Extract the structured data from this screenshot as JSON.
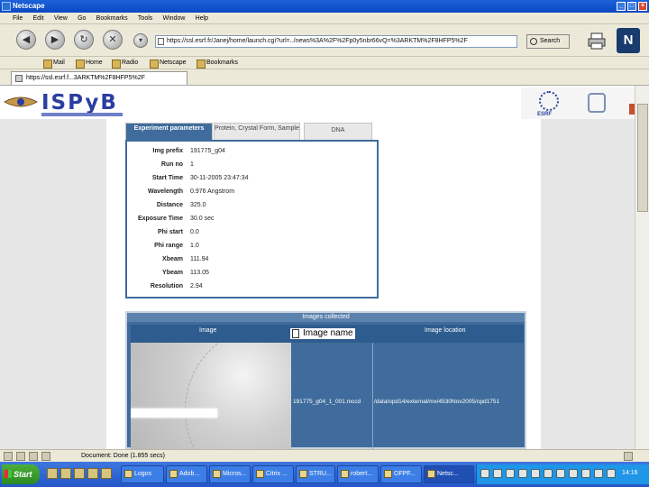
{
  "window": {
    "title": "Netscape"
  },
  "menu": [
    "File",
    "Edit",
    "View",
    "Go",
    "Bookmarks",
    "Tools",
    "Window",
    "Help"
  ],
  "nav": {
    "url": "https://ssl.esrf.fr/Janej/home/launch.cgi?url=../news%3A%2F%2Fp0y5nbr66vQ=%3ARKTM%2F8HFP5%2F",
    "search_label": "Search"
  },
  "bookmarks": [
    "Mail",
    "Home",
    "Radio",
    "Netscape",
    "Bookmarks"
  ],
  "tab": {
    "label": "https://ssl.esrf.f...3ARKTM%2F8HFP5%2F"
  },
  "banner": {
    "logo_text": "ISPyB",
    "esrf_label": "ESRF"
  },
  "param_tabs": [
    {
      "label": "Experiment parameters",
      "active": true
    },
    {
      "label": "Protein, Crystal Form, Sample",
      "active": false
    },
    {
      "label": "DNA",
      "active": false
    }
  ],
  "params": [
    {
      "label": "Img prefix",
      "value": "191775_g04"
    },
    {
      "label": "Run no",
      "value": "1"
    },
    {
      "label": "Start Time",
      "value": "30-11-2005 23:47:34"
    },
    {
      "label": "Wavelength",
      "value": "0.976 Angstrom"
    },
    {
      "label": "Distance",
      "value": "325.0"
    },
    {
      "label": "Exposure Time",
      "value": "30.0 sec"
    },
    {
      "label": "Phi start",
      "value": "0.0"
    },
    {
      "label": "Phi range",
      "value": "1.0"
    },
    {
      "label": "Xbeam",
      "value": "111.94"
    },
    {
      "label": "Ybeam",
      "value": "113.05"
    },
    {
      "label": "Resolution",
      "value": "2.94"
    }
  ],
  "images": {
    "title": "Images collected",
    "col_image": "Image",
    "col_name": "Image name",
    "col_location": "Image location",
    "file_name": "191775_g04_1_001.mccd",
    "location": "/data/opd14/external/mx/4530Nov2005/opd1751"
  },
  "status": {
    "text": "Document: Done (1.855 secs)"
  },
  "taskbar": {
    "start": "Start",
    "tasks": [
      {
        "label": "Logos",
        "active": false
      },
      {
        "label": "Adob...",
        "active": false
      },
      {
        "label": "Micros...",
        "active": false
      },
      {
        "label": "Citrix ...",
        "active": false
      },
      {
        "label": "STRU...",
        "active": false
      },
      {
        "label": "robert...",
        "active": false
      },
      {
        "label": "OFPF...",
        "active": false
      },
      {
        "label": "Netsc...",
        "active": true
      }
    ],
    "clock": "14:16"
  }
}
